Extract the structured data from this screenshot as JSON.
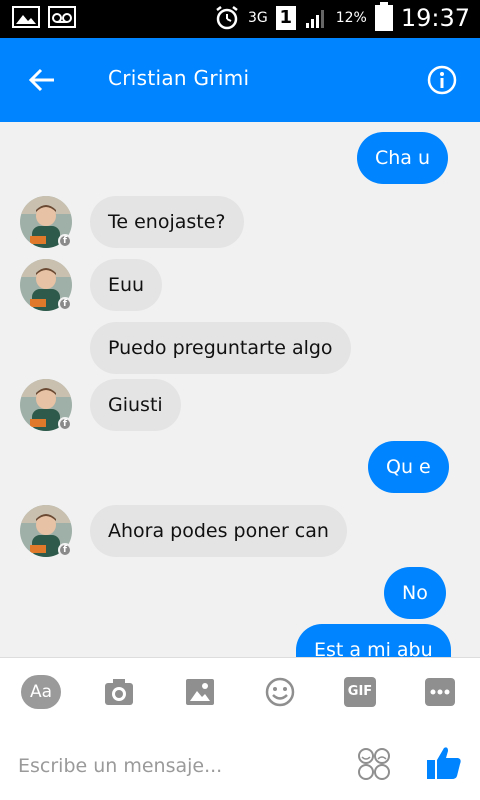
{
  "status_bar": {
    "network": "3G",
    "sim": "1",
    "battery": "12%",
    "time": "19:37"
  },
  "header": {
    "title": "Cristian Grimi"
  },
  "messages": [
    {
      "from": "me",
      "text": "Cha u"
    },
    {
      "from": "them",
      "text": "Te enojaste?"
    },
    {
      "from": "them",
      "text": "Euu"
    },
    {
      "from": "them",
      "text": "Puedo preguntarte algo"
    },
    {
      "from": "them",
      "text": "Giusti"
    },
    {
      "from": "me",
      "text": "Qu e"
    },
    {
      "from": "them",
      "text": "Ahora podes poner can"
    },
    {
      "from": "me",
      "text": "No"
    },
    {
      "from": "me",
      "text": "Est a mi abu"
    }
  ],
  "toolbar": {
    "text_label": "Aa",
    "gif_label": "GIF"
  },
  "composer": {
    "placeholder": "Escribe un mensaje..."
  },
  "colors": {
    "accent": "#0084ff",
    "incoming_bubble": "#e4e4e4",
    "background": "#f1f1f1"
  }
}
